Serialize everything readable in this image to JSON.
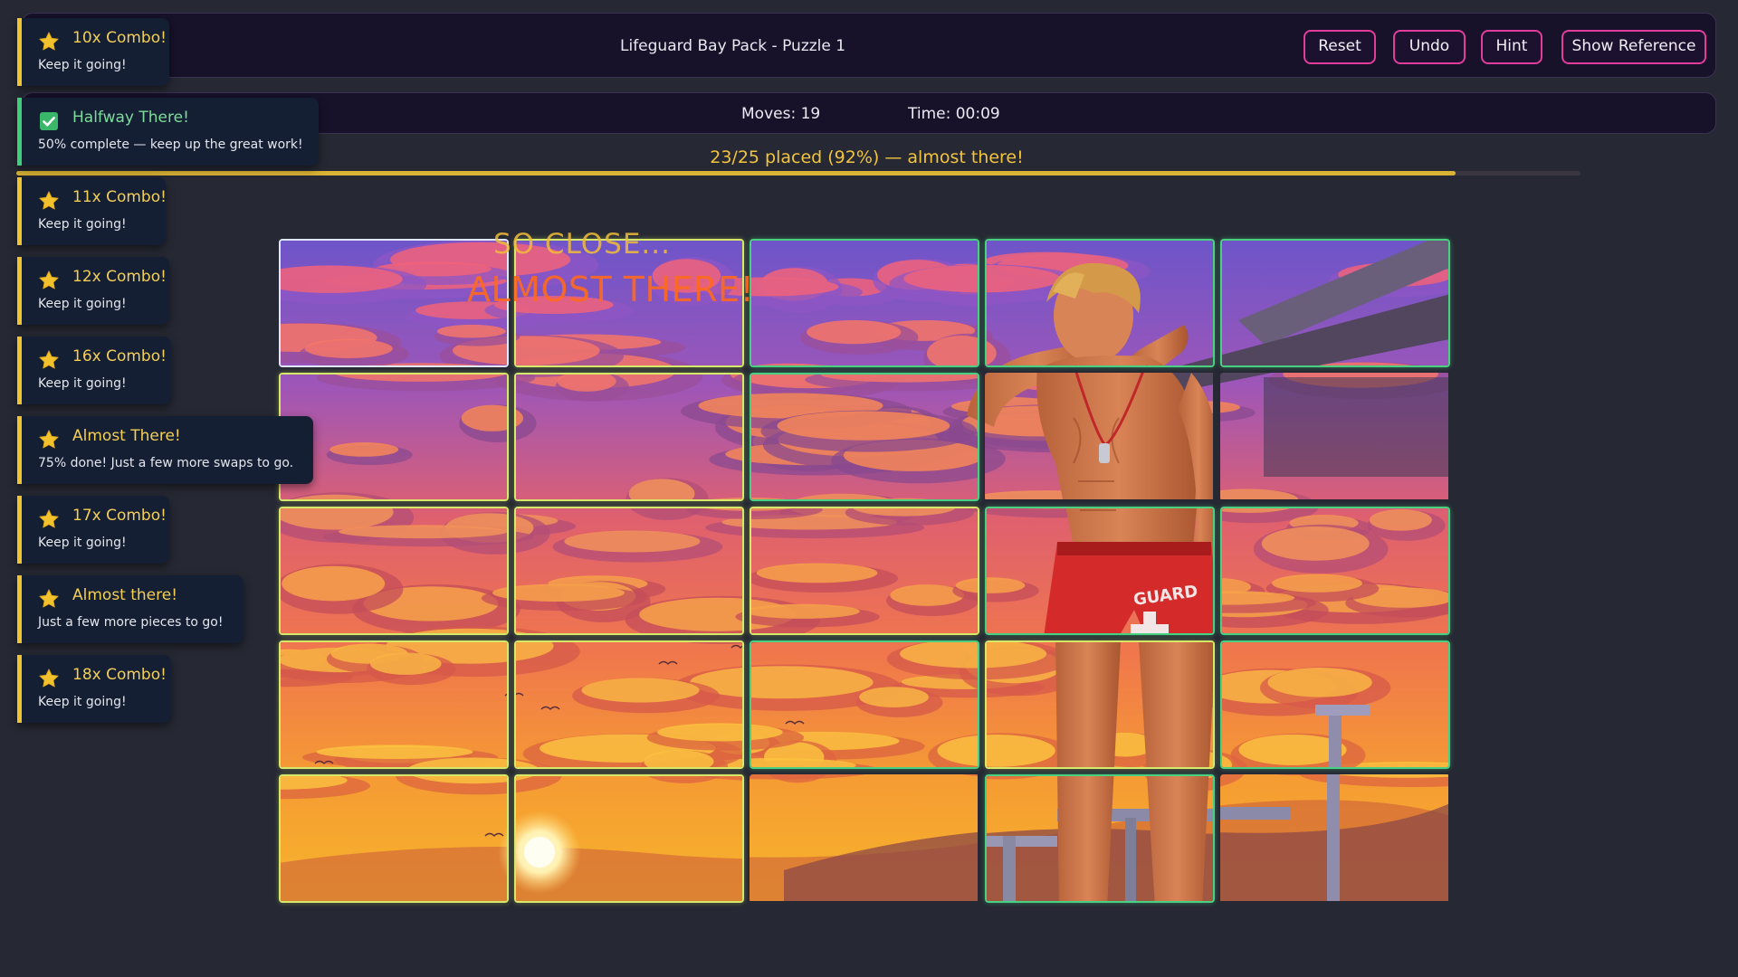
{
  "header": {
    "title": "Lifeguard Bay Pack - Puzzle 1",
    "buttons": {
      "reset": "Reset",
      "undo": "Undo",
      "hint": "Hint",
      "reference": "Show Reference"
    }
  },
  "stats": {
    "moves": "Moves: 19",
    "time": "Time: 00:09"
  },
  "progress": {
    "text": "23/25 placed (92%) — almost there!",
    "fraction": 0.92
  },
  "overlay": {
    "line1": "SO CLOSE...",
    "line2": "ALMOST THERE!"
  },
  "toasts": [
    {
      "icon": "star-icon",
      "title": "10x Combo!",
      "sub": "Keep it going!",
      "style": "yellow"
    },
    {
      "icon": "check-icon",
      "title": "Halfway There!",
      "sub": "50% complete — keep up the great work!",
      "style": "green"
    },
    {
      "icon": "star-icon",
      "title": "11x Combo!",
      "sub": "Keep it going!",
      "style": "yellow"
    },
    {
      "icon": "star-icon",
      "title": "12x Combo!",
      "sub": "Keep it going!",
      "style": "yellow"
    },
    {
      "icon": "star-icon",
      "title": "16x Combo!",
      "sub": "Keep it going!",
      "style": "yellow"
    },
    {
      "icon": "star-icon",
      "title": "Almost There!",
      "sub": "75% done! Just a few more swaps to go.",
      "style": "yellow"
    },
    {
      "icon": "star-icon",
      "title": "17x Combo!",
      "sub": "Keep it going!",
      "style": "yellow"
    },
    {
      "icon": "star-icon",
      "title": "Almost there!",
      "sub": "Just a few more pieces to go!",
      "style": "yellow"
    },
    {
      "icon": "star-icon",
      "title": "18x Combo!",
      "sub": "Keep it going!",
      "style": "yellow"
    }
  ],
  "board": {
    "rows": 5,
    "cols": 5,
    "placed": 23,
    "total": 25,
    "tile_states": [
      [
        "selected",
        "yellowish",
        "correct",
        "correct",
        "correct"
      ],
      [
        "yellowish",
        "yellowish",
        "correct",
        "plain",
        "plain"
      ],
      [
        "yellowish",
        "yellowish",
        "yellowish",
        "correct",
        "correct"
      ],
      [
        "yellowish",
        "yellowish",
        "correct",
        "yellowish",
        "correct"
      ],
      [
        "yellowish",
        "yellowish",
        "plain",
        "correct",
        "plain"
      ]
    ]
  },
  "colors": {
    "accent_button_border": "#e23d9b",
    "toast_yellow": "#f0c330",
    "toast_green": "#3fcf7a",
    "progress": "#d9b334",
    "correct_border": "#49d181"
  }
}
